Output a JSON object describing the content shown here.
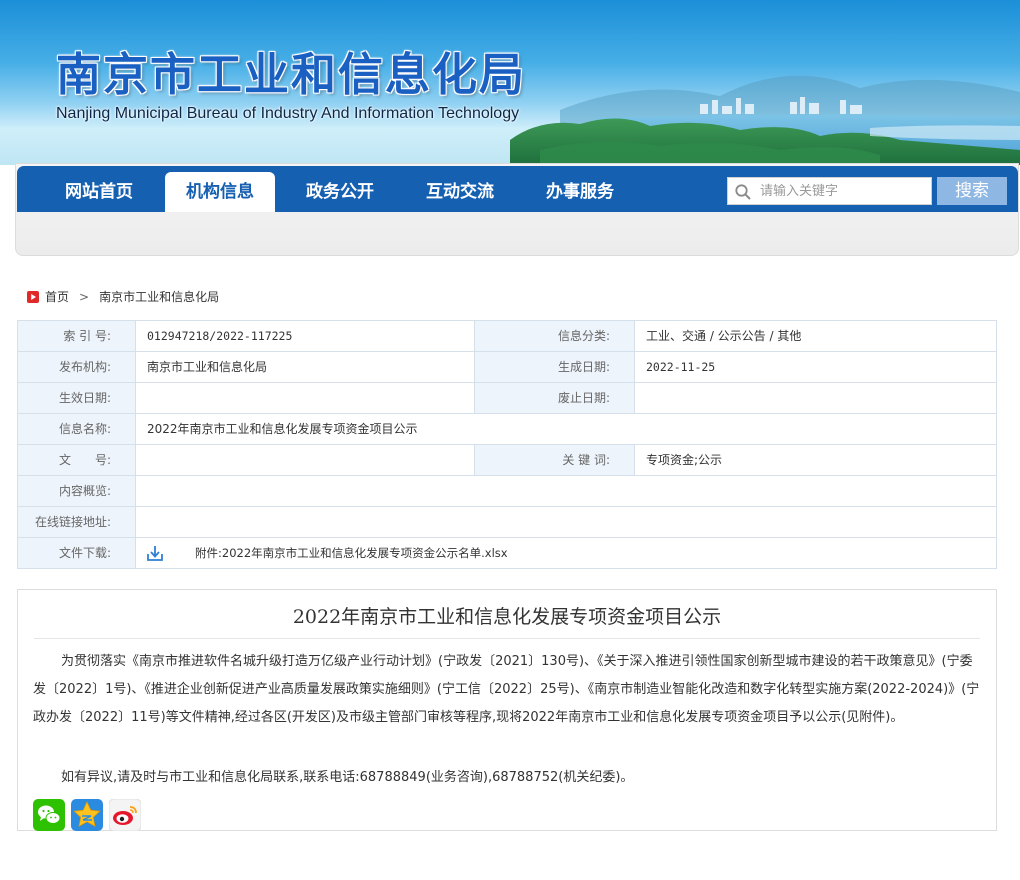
{
  "site": {
    "title": "南京市工业和信息化局",
    "subtitle": "Nanjing Municipal Bureau of Industry And Information Technology"
  },
  "nav": {
    "items": [
      "网站首页",
      "机构信息",
      "政务公开",
      "互动交流",
      "办事服务"
    ],
    "active_index": 1,
    "search_placeholder": "请输入关键字",
    "search_button": "搜索"
  },
  "breadcrumb": {
    "home": "首页",
    "current": "南京市工业和信息化局"
  },
  "meta": {
    "index_label": "索 引 号:",
    "index_value": "012947218/2022-117225",
    "category_label": "信息分类:",
    "category_value": "工业、交通 / 公示公告 / 其他",
    "publisher_label": "发布机构:",
    "publisher_value": "南京市工业和信息化局",
    "created_label": "生成日期:",
    "created_value": "2022-11-25",
    "effective_label": "生效日期:",
    "effective_value": "",
    "expiry_label": "废止日期:",
    "expiry_value": "",
    "name_label": "信息名称:",
    "name_value": "2022年南京市工业和信息化发展专项资金项目公示",
    "docno_label": "文　　号:",
    "docno_value": "",
    "keywords_label": "关 键 词:",
    "keywords_value": "专项资金;公示",
    "summary_label": "内容概览:",
    "summary_value": "",
    "link_label": "在线链接地址:",
    "link_value": "",
    "download_label": "文件下载:",
    "attachment": "附件:2022年南京市工业和信息化发展专项资金公示名单.xlsx"
  },
  "article": {
    "title": "2022年南京市工业和信息化发展专项资金项目公示",
    "paragraph1": "为贯彻落实《南京市推进软件名城升级打造万亿级产业行动计划》(宁政发〔2021〕130号)、《关于深入推进引领性国家创新型城市建设的若干政策意见》(宁委发〔2022〕1号)、《推进企业创新促进产业高质量发展政策实施细则》(宁工信〔2022〕25号)、《南京市制造业智能化改造和数字化转型实施方案(2022-2024)》(宁政办发〔2022〕11号)等文件精神,经过各区(开发区)及市级主管部门审核等程序,现将2022年南京市工业和信息化发展专项资金项目予以公示(见附件)。",
    "paragraph2": "如有异议,请及时与市工业和信息化局联系,联系电话:68788849(业务咨询),68788752(机关纪委)。"
  },
  "share": {
    "icons": [
      "wechat-icon",
      "qzone-icon",
      "weibo-icon"
    ]
  },
  "colors": {
    "nav_blue": "#1660b2",
    "label_bg": "#eef4fb",
    "search_button": "#8fb7e3"
  }
}
